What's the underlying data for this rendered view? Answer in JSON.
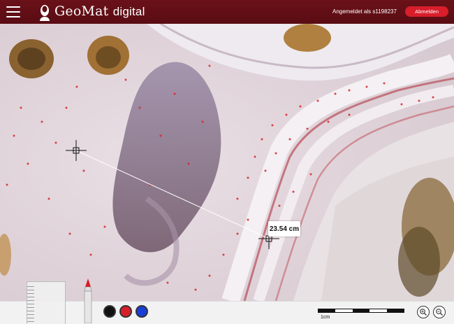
{
  "header": {
    "brand_main": "GeoMat",
    "brand_sub": "digital",
    "login_status": "Angemeldet als s1198237",
    "logout_label": "Abmelden",
    "menu_icon": "hamburger-menu-icon",
    "logo_icon": "portrait-logo-icon"
  },
  "measurement": {
    "distance_label": "23.54 cm"
  },
  "toolbar": {
    "ruler_icon": "ruler-icon",
    "pen_icon": "pen-icon",
    "colors": [
      "#111111",
      "#d81e2b",
      "#1a3ed8"
    ],
    "scale_label": "1cm",
    "zoom_in_icon": "zoom-in-icon",
    "zoom_out_icon": "zoom-out-icon"
  },
  "colors": {
    "header_bg": "#5e0d14",
    "accent_red": "#d81e2b"
  }
}
